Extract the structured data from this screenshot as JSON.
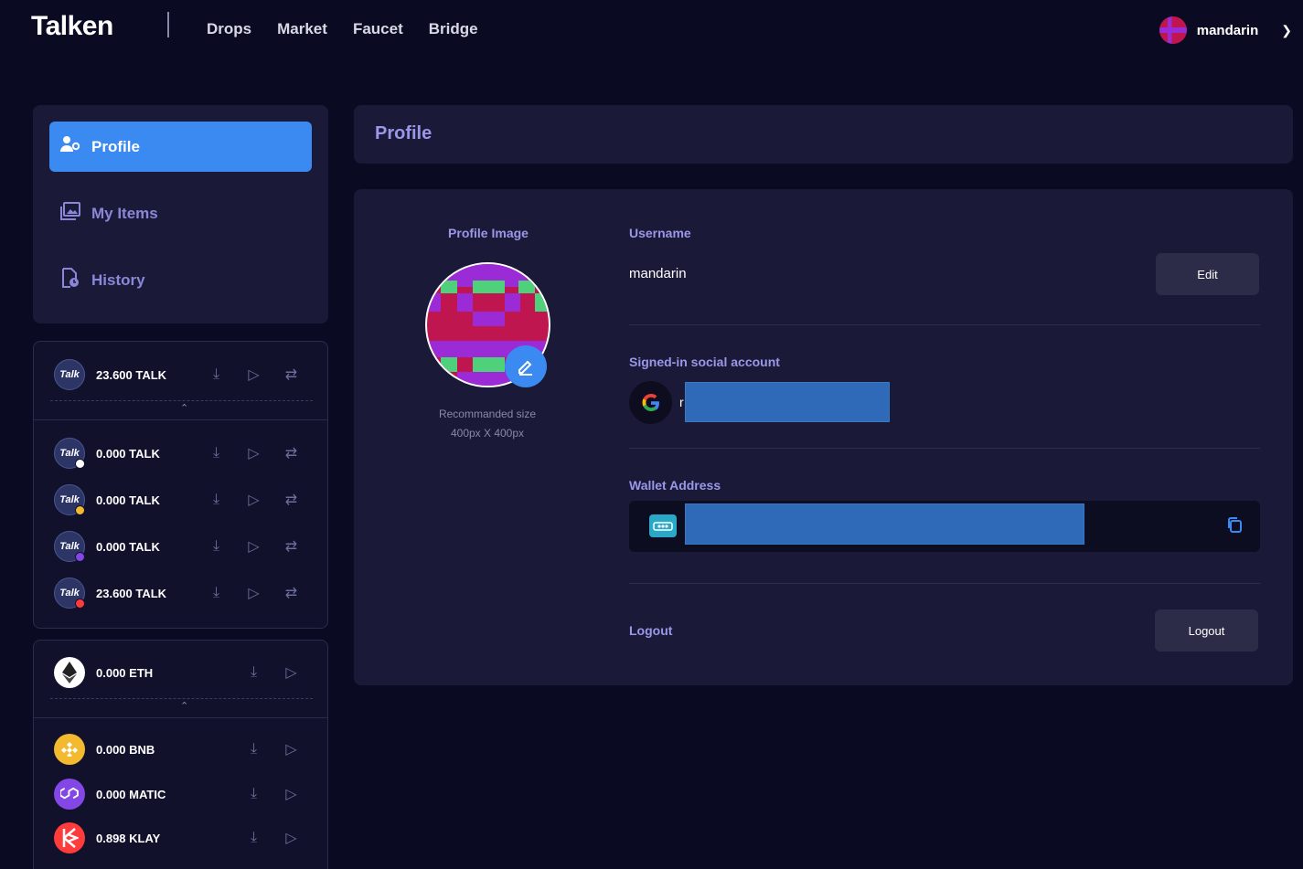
{
  "brand": {
    "logo": "Talken"
  },
  "nav": {
    "items": [
      "Drops",
      "Market",
      "Faucet",
      "Bridge"
    ]
  },
  "user": {
    "name": "mandarin"
  },
  "sidebar": {
    "menu": [
      {
        "label": "Profile",
        "icon": "user-gear-icon",
        "active": true
      },
      {
        "label": "My Items",
        "icon": "images-icon",
        "active": false
      },
      {
        "label": "History",
        "icon": "file-clock-icon",
        "active": false
      }
    ],
    "talk_tokens": {
      "primary": {
        "amount": "23.600 TALK",
        "icon_text": "Talk"
      },
      "networks": [
        {
          "amount": "0.000 TALK",
          "icon_text": "Talk",
          "badge_color": "#ffffff"
        },
        {
          "amount": "0.000 TALK",
          "icon_text": "Talk",
          "badge_color": "#f3ba2f"
        },
        {
          "amount": "0.000 TALK",
          "icon_text": "Talk",
          "badge_color": "#8247e5"
        },
        {
          "amount": "23.600 TALK",
          "icon_text": "Talk",
          "badge_color": "#ff3b3b"
        }
      ]
    },
    "chain_tokens": {
      "primary": {
        "amount": "0.000 ETH",
        "symbol": "ETH"
      },
      "others": [
        {
          "amount": "0.000 BNB",
          "symbol": "BNB",
          "color": "#f3ba2f"
        },
        {
          "amount": "0.000 MATIC",
          "symbol": "MATIC",
          "color": "#8247e5"
        },
        {
          "amount": "0.898 KLAY",
          "symbol": "KLAY",
          "color": "#ff3b3b"
        }
      ]
    }
  },
  "main": {
    "title": "Profile",
    "profile_image": {
      "label": "Profile Image",
      "hint_line1": "Recommanded size",
      "hint_line2": "400px X 400px"
    },
    "username": {
      "label": "Username",
      "value": "mandarin",
      "edit_label": "Edit"
    },
    "social": {
      "label": "Signed-in social account",
      "provider": "G",
      "value_prefix": "r"
    },
    "wallet": {
      "label": "Wallet Address"
    },
    "logout": {
      "label": "Logout",
      "button": "Logout"
    }
  },
  "colors": {
    "background": "#0a0a22",
    "card": "#1a1a38",
    "accent": "#3b8af2",
    "label": "#9b97e8"
  }
}
